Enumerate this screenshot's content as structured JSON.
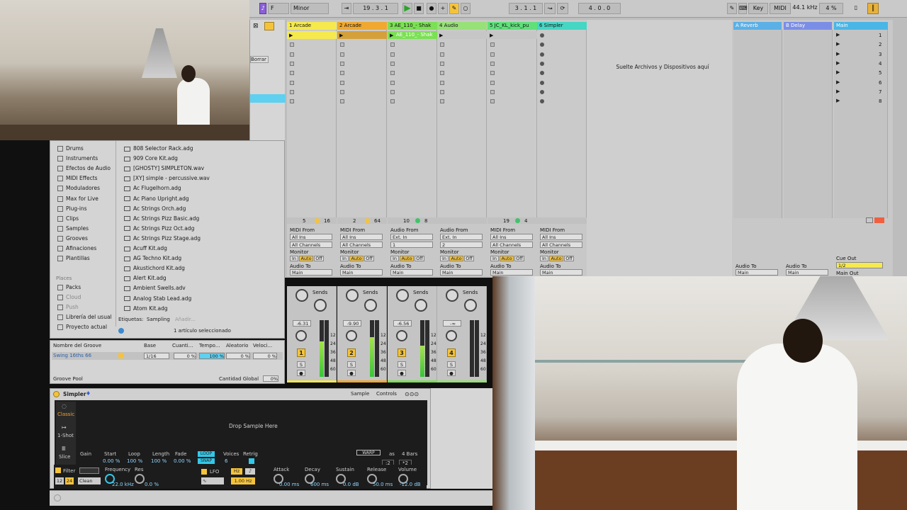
{
  "transport": {
    "mode": "F",
    "scale": "Minor",
    "position": "19 . 3 . 1",
    "loop_start": "3 . 1 . 1",
    "loop_length": "4 . 0 . 0",
    "key_label": "Key",
    "midi_label": "MIDI",
    "sample_rate": "44.1 kHz",
    "cpu": "4 %"
  },
  "session": {
    "tracks": [
      {
        "name": "1 Arcade",
        "color": "#f5e94d",
        "clip": "",
        "num_a": "5",
        "num_b": "16",
        "from_label": "MIDI From",
        "from": "All Ins",
        "channel": "All Channels",
        "to": "Main",
        "volume": "-6.31",
        "number": "1"
      },
      {
        "name": "2 Arcade",
        "color": "#f0a830",
        "clip": "",
        "num_a": "2",
        "num_b": "64",
        "from_label": "MIDI From",
        "from": "All Ins",
        "channel": "All Channels",
        "to": "Main",
        "volume": "-9.90",
        "number": "2"
      },
      {
        "name": "3 AE_110_- Shak",
        "color": "#7be054",
        "clip": "AE_110_- Shak",
        "num_a": "10",
        "num_b": "8",
        "from_label": "Audio From",
        "from": "Ext. In",
        "channel": "1",
        "to": "Main",
        "volume": "-6.56",
        "number": "3"
      },
      {
        "name": "4 Audio",
        "color": "#98e078",
        "clip": "",
        "num_a": "",
        "num_b": "",
        "from_label": "Audio From",
        "from": "Ext. In",
        "channel": "2",
        "to": "Main",
        "volume": "-∞",
        "number": "4"
      },
      {
        "name": "5 JC_KL_kick_pu",
        "color": "#5fe07a",
        "clip": "",
        "num_a": "19",
        "num_b": "4",
        "from_label": "MIDI From",
        "from": "All Ins",
        "channel": "All Channels",
        "to": "Main",
        "volume": "",
        "number": ""
      },
      {
        "name": "6 Simpler",
        "color": "#45d6c4",
        "clip": "",
        "num_a": "",
        "num_b": "",
        "from_label": "MIDI From",
        "from": "All Ins",
        "channel": "All Channels",
        "to": "Main",
        "volume": "",
        "number": ""
      }
    ],
    "returns": [
      {
        "name": "A Reverb",
        "color": "#5bb0e6",
        "to": "Main",
        "to_label": "Audio To"
      },
      {
        "name": "B Delay",
        "color": "#7b8ee6",
        "to": "Main",
        "to_label": "Audio To"
      }
    ],
    "main": {
      "name": "Main",
      "color": "#49b6e6",
      "scenes": [
        "1",
        "2",
        "3",
        "4",
        "5",
        "6",
        "7",
        "8"
      ],
      "cue_label": "Cue Out",
      "cue_value": "1/2",
      "main_out": "Main Out"
    },
    "drop_text": "Suelte Archivos y Dispositivos aquí",
    "monitor_label": "Monitor",
    "in_label": "In",
    "auto_label": "Auto",
    "off_label": "Off",
    "audio_to_label": "Audio To",
    "sends_label": "Sends",
    "db_ticks": [
      "12",
      "24",
      "36",
      "48",
      "60"
    ]
  },
  "browser": {
    "categories": [
      "Drums",
      "Instruments",
      "Efectos de Audio",
      "MIDI Effects",
      "Moduladores",
      "Max for Live",
      "Plug-ins",
      "Clips",
      "Samples",
      "Grooves",
      "Afinaciones",
      "Plantillas"
    ],
    "places_label": "Places",
    "places": [
      "Packs",
      "Cloud",
      "Push",
      "Librería del usual",
      "Proyecto actual"
    ],
    "files": [
      "808 Selector Rack.adg",
      "909 Core Kit.adg",
      "[GHOSTY] SIMPLETON.wav",
      "[XY] simple - percussive.wav",
      "Ac Flugelhorn.adg",
      "Ac Piano Upright.adg",
      "Ac Strings Orch.adg",
      "Ac Strings Pizz Basic.adg",
      "Ac Strings Pizz Oct.adg",
      "Ac Strings Pizz Stage.adg",
      "Acuff Kit.adg",
      "AG Techno Kit.adg",
      "Akustichord Kit.adg",
      "Alert Kit.adg",
      "Ambient Swells.adv",
      "Analog Stab Lead.adg",
      "Atom Kit.adg"
    ],
    "tags_label": "Etiquetas:",
    "tag_sampling": "Sampling",
    "tag_add": "Añadir...",
    "selected_info": "1 artículo seleccionado",
    "borrar": "Borrar"
  },
  "groove": {
    "headers": [
      "Nombre del Groove",
      "Base",
      "Cuanti...",
      "Tempo...",
      "Aleatorio",
      "Veloci..."
    ],
    "row": {
      "name": "Swing 16ths 66",
      "base": "1/16",
      "quant": "0 %",
      "tempo": "100 %",
      "random": "0 %",
      "velocity": "0 %"
    },
    "pool_label": "Groove Pool",
    "global_label": "Cantidad Global",
    "global_value": "0%"
  },
  "simpler": {
    "title": "Simpler",
    "tab_sample": "Sample",
    "tab_controls": "Controls",
    "mode_classic": "Classic",
    "mode_oneshot": "1-Shot",
    "mode_slice": "Slice",
    "drop_text": "Drop Sample Here",
    "warp": "WARP",
    "as_label": "as",
    "bars": "4 Bars",
    "div2": ":2",
    "mul2": "*2",
    "params": [
      {
        "label": "Gain",
        "value": ""
      },
      {
        "label": "Start",
        "value": "0.00 %"
      },
      {
        "label": "Loop",
        "value": "100 %"
      },
      {
        "label": "Length",
        "value": "100 %"
      },
      {
        "label": "Fade",
        "value": "0.00 %"
      }
    ],
    "loop_btn": "LOOP",
    "snap_btn": "SNAP",
    "voices_label": "Voices",
    "voices": "6",
    "retrig_label": "Retrig",
    "filter_label": "Filter",
    "filter_12": "12",
    "filter_24": "24",
    "filter_clean": "Clean",
    "frequency_label": "Frequency",
    "frequency": "22.0 kHz",
    "res_label": "Res",
    "res": "0.0 %",
    "lfo_label": "LFO",
    "lfo_hz_btn": "Hz",
    "lfo_rate": "1.00 Hz",
    "attack_label": "Attack",
    "attack": "0.00 ms",
    "decay_label": "Decay",
    "decay": "600 ms",
    "sustain_label": "Sustain",
    "sustain": "0.0 dB",
    "release_label": "Release",
    "release": "50.0 ms",
    "volume_label": "Volume",
    "volume": "-12.0 dB"
  }
}
